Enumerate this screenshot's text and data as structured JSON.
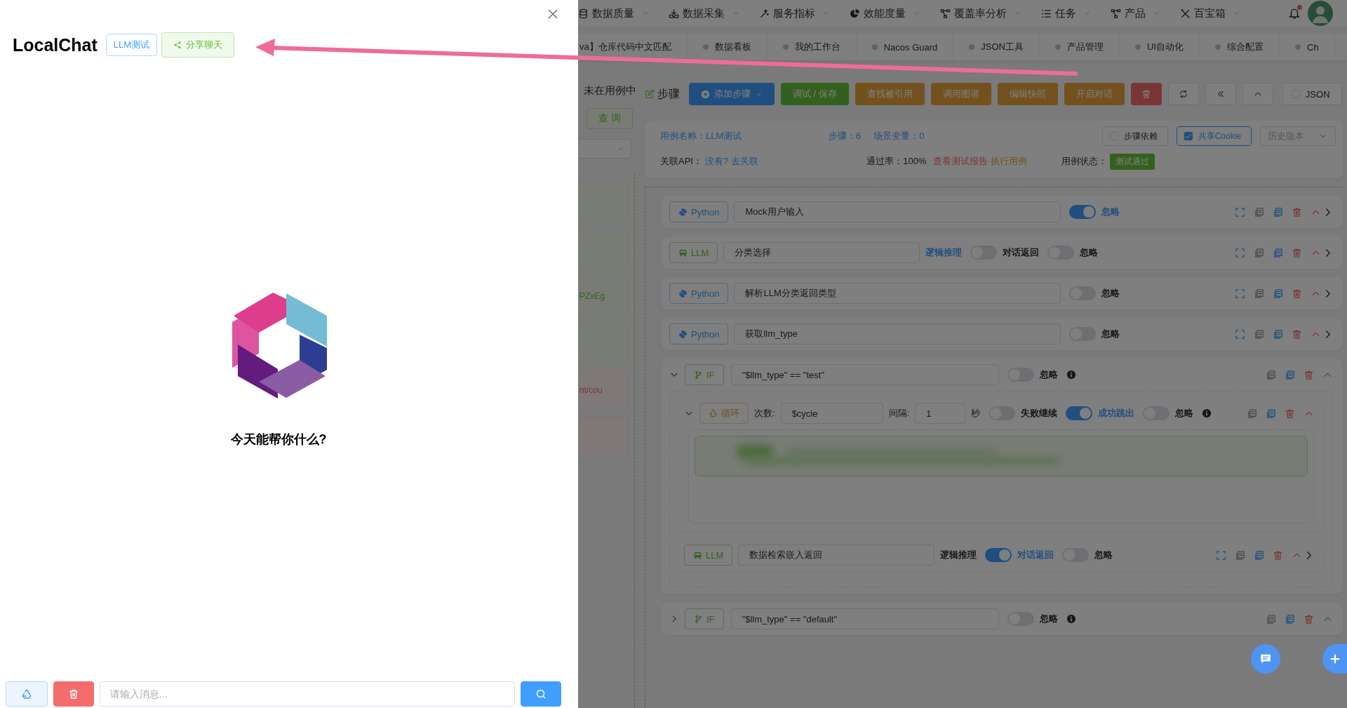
{
  "drawer": {
    "title": "LocalChat",
    "tag": "LLM测试",
    "share_button": "分享聊天",
    "greeting": "今天能帮你什么?",
    "input": {
      "placeholder": "请输入消息..."
    }
  },
  "top_nav": {
    "items": [
      "数据质量",
      "数据采集",
      "服务指标",
      "效能度量",
      "覆盖率分析",
      "任务",
      "产品",
      "百宝箱"
    ],
    "unread": true
  },
  "tabs": [
    {
      "label": "va】仓库代码中文匹配",
      "selected": false
    },
    {
      "label": "数据看板",
      "selected": false
    },
    {
      "label": "我的工作台",
      "selected": false
    },
    {
      "label": "Nacos Guard",
      "selected": false
    },
    {
      "label": "JSON工具",
      "selected": false
    },
    {
      "label": "产品管理",
      "selected": false
    },
    {
      "label": "UI自动化",
      "selected": false
    },
    {
      "label": "综合配置",
      "selected": false
    },
    {
      "label": "Ch",
      "selected": false
    }
  ],
  "case_list": {
    "status": "未在用例中",
    "query_button": "查 询",
    "cards": [
      {
        "kind": "pass"
      },
      {
        "kind": "pass"
      },
      {
        "kind": "pass",
        "text": "PZxEg"
      },
      {
        "kind": "pass"
      },
      {
        "kind": "fail",
        "text": "nt/cou"
      },
      {
        "kind": "fail"
      }
    ]
  },
  "toolbar": {
    "title": "步骤",
    "buttons": [
      {
        "kind": "primary",
        "label": "添加步骤",
        "dropdown": true
      },
      {
        "kind": "success",
        "label": "调试 / 保存"
      },
      {
        "kind": "warning",
        "label": "查找被引用"
      },
      {
        "kind": "warning",
        "label": "调用图谱"
      },
      {
        "kind": "warning",
        "label": "编辑快照"
      },
      {
        "kind": "warning",
        "label": "开启对话"
      },
      {
        "kind": "danger"
      },
      {
        "kind": "refresh"
      },
      {
        "kind": "collapse"
      },
      {
        "kind": "up"
      }
    ],
    "json_toggle": {
      "label": "JSON",
      "checked": false
    }
  },
  "case_info": {
    "name": "用例名称：LLM测试",
    "steps": "步骤：6",
    "vars": "场景变量：0",
    "dependency": {
      "label": "步骤依赖",
      "checked": false
    },
    "share_cookie": {
      "label": "共享Cookie",
      "checked": true
    },
    "history": {
      "placeholder": "历史版本"
    },
    "api_label": "关联API：",
    "api_links": [
      "没有?",
      "去关联"
    ],
    "pass_rate": "通过率：100%",
    "report_link": "查看测试报告",
    "run_link": "执行用例",
    "status_label": "用例状态：",
    "status": "测试通过"
  },
  "steps": [
    {
      "kind": "python",
      "tag": "Python",
      "value": "Mock用户输入",
      "switches": [
        {
          "right": "忽略",
          "on": true
        }
      ]
    },
    {
      "kind": "llm",
      "tag": "LLM",
      "value": "分类选择",
      "switches": [
        {
          "left": "逻辑推理",
          "right": "对话返回",
          "on": false
        },
        {
          "right": "忽略",
          "on": false
        }
      ]
    },
    {
      "kind": "python",
      "tag": "Python",
      "value": "解析LLM分类返回类型",
      "switches": [
        {
          "right": "忽略",
          "on": false
        }
      ]
    },
    {
      "kind": "python",
      "tag": "Python",
      "value": "获取llm_type",
      "switches": [
        {
          "right": "忽略",
          "on": false
        }
      ]
    },
    {
      "kind": "if",
      "tag": "IF",
      "value": "\"$llm_type\" == \"test\"",
      "expanded": true,
      "switches": [
        {
          "right": "忽略",
          "on": false
        }
      ],
      "children": [
        {
          "kind": "loop",
          "tag": "循环",
          "count_label": "次数:",
          "count": "$cycle",
          "interval_label": "间隔:",
          "interval": "1",
          "unit": "秒",
          "expanded": true,
          "switches": [
            {
              "right": "失败继续",
              "on": false
            },
            {
              "right": "成功跳出",
              "on": true
            },
            {
              "right": "忽略",
              "on": false
            }
          ],
          "children": [
            {
              "kind": "blurred"
            }
          ]
        },
        {
          "kind": "llm",
          "tag": "LLM",
          "value": "数据检索嵌入返回",
          "switches": [
            {
              "left": "逻辑推理",
              "right": "对话返回",
              "on": true
            },
            {
              "right": "忽略",
              "on": false
            }
          ]
        }
      ]
    },
    {
      "kind": "if",
      "tag": "IF",
      "value": "\"$llm_type\" == \"default\"",
      "expanded": false,
      "switches": [
        {
          "right": "忽略",
          "on": false
        }
      ]
    }
  ]
}
